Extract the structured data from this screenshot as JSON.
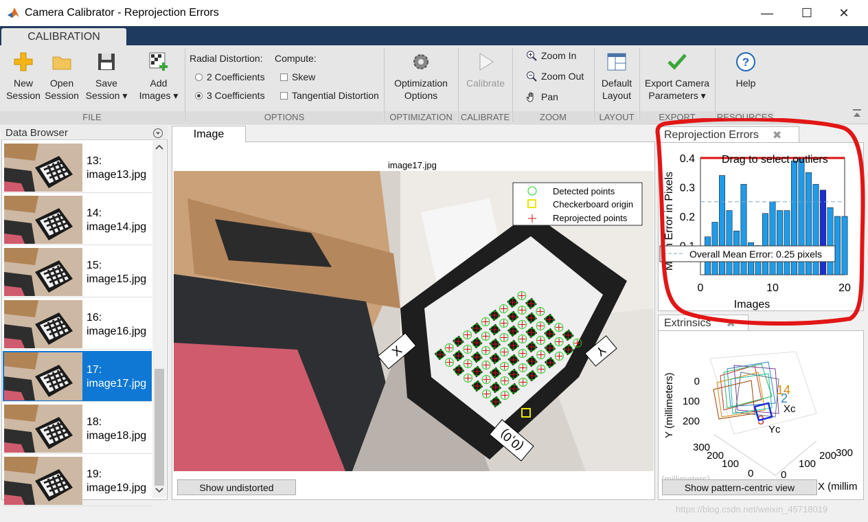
{
  "window": {
    "title": "Camera Calibrator - Reprojection Errors",
    "controls": [
      "—",
      "☐",
      "✕"
    ]
  },
  "ribbon": {
    "tab": "CALIBRATION",
    "file": {
      "group_label": "FILE",
      "new_session": [
        "New",
        "Session"
      ],
      "open_session": [
        "Open",
        "Session"
      ],
      "save_session": [
        "Save",
        "Session ▾"
      ],
      "add_images": [
        "Add",
        "Images ▾"
      ]
    },
    "options": {
      "group_label": "OPTIONS",
      "radial_label": "Radial Distortion:",
      "compute_label": "Compute:",
      "two_coeff": "2 Coefficients",
      "three_coeff": "3 Coefficients",
      "skew": "Skew",
      "tangential": "Tangential Distortion",
      "selected_radial": "3 Coefficients"
    },
    "optimization": {
      "group_label": "OPTIMIZATION",
      "label": [
        "Optimization",
        "Options"
      ]
    },
    "calibrate": {
      "group_label": "CALIBRATE",
      "label": "Calibrate"
    },
    "zoom": {
      "group_label": "ZOOM",
      "zoom_in": "Zoom In",
      "zoom_out": "Zoom Out",
      "pan": "Pan"
    },
    "layout": {
      "group_label": "LAYOUT",
      "label": [
        "Default",
        "Layout"
      ]
    },
    "export": {
      "group_label": "EXPORT",
      "label": [
        "Export Camera",
        "Parameters ▾"
      ]
    },
    "resources": {
      "group_label": "RESOURCES",
      "label": "Help"
    }
  },
  "data_browser": {
    "title": "Data Browser",
    "items": [
      {
        "index": "13:",
        "file": "image13.jpg",
        "selected": false
      },
      {
        "index": "14:",
        "file": "image14.jpg",
        "selected": false
      },
      {
        "index": "15:",
        "file": "image15.jpg",
        "selected": false
      },
      {
        "index": "16:",
        "file": "image16.jpg",
        "selected": false
      },
      {
        "index": "17:",
        "file": "image17.jpg",
        "selected": true
      },
      {
        "index": "18:",
        "file": "image18.jpg",
        "selected": false
      },
      {
        "index": "19:",
        "file": "image19.jpg",
        "selected": false
      }
    ]
  },
  "image_panel": {
    "tab": "Image",
    "image_title": "image17.jpg",
    "legend": [
      "Detected points",
      "Checkerboard origin",
      "Reprojected points"
    ],
    "axis_labels": [
      "X",
      "Y",
      "(0,0)"
    ],
    "button": "Show undistorted"
  },
  "reprojection_panel": {
    "tab": "Reprojection Errors",
    "overlay_text": "Drag to select outliers",
    "mean_label": "Overall Mean Error: 0.25 pixels",
    "ylabel": "Mean Error in Pixels",
    "xlabel": "Images"
  },
  "extrinsics_panel": {
    "tab": "Extrinsics",
    "ylabel": "Y (millimeters)",
    "xlabel": "X (millim",
    "zlabel": "(millimeters)",
    "y_ticks": [
      "0",
      "100",
      "200"
    ],
    "z_ticks": [
      "300",
      "200",
      "100",
      "0"
    ],
    "x_ticks": [
      "0",
      "100",
      "200",
      "300"
    ],
    "camera_labels": [
      "Xc",
      "Yc"
    ],
    "button": "Show pattern-centric view"
  },
  "chart_data": {
    "type": "bar",
    "title": "",
    "xlabel": "Images",
    "ylabel": "Mean Error in Pixels",
    "categories": [
      1,
      2,
      3,
      4,
      5,
      6,
      7,
      8,
      9,
      10,
      11,
      12,
      13,
      14,
      15,
      16,
      17,
      18,
      19
    ],
    "values": [
      0.13,
      0.18,
      0.34,
      0.22,
      0.15,
      0.31,
      0.11,
      0.1,
      0.21,
      0.25,
      0.22,
      0.22,
      0.39,
      0.4,
      0.35,
      0.31,
      0.29,
      0.23,
      0.2,
      0.2
    ],
    "highlighted_index": 17,
    "mean": 0.25,
    "xlim": [
      0,
      20
    ],
    "ylim": [
      0,
      0.4
    ],
    "x_ticks": [
      "0",
      "10",
      "20"
    ],
    "y_ticks": [
      "0.1",
      "0.2",
      "0.3",
      "0.4"
    ],
    "colors": {
      "bar": "#1e9be9",
      "highlight": "#1b2fd6",
      "mean_line": "#7fa7c9",
      "outlier_line": "#e01010"
    }
  },
  "watermark": "https://blog.csdn.net/weixin_45718019"
}
